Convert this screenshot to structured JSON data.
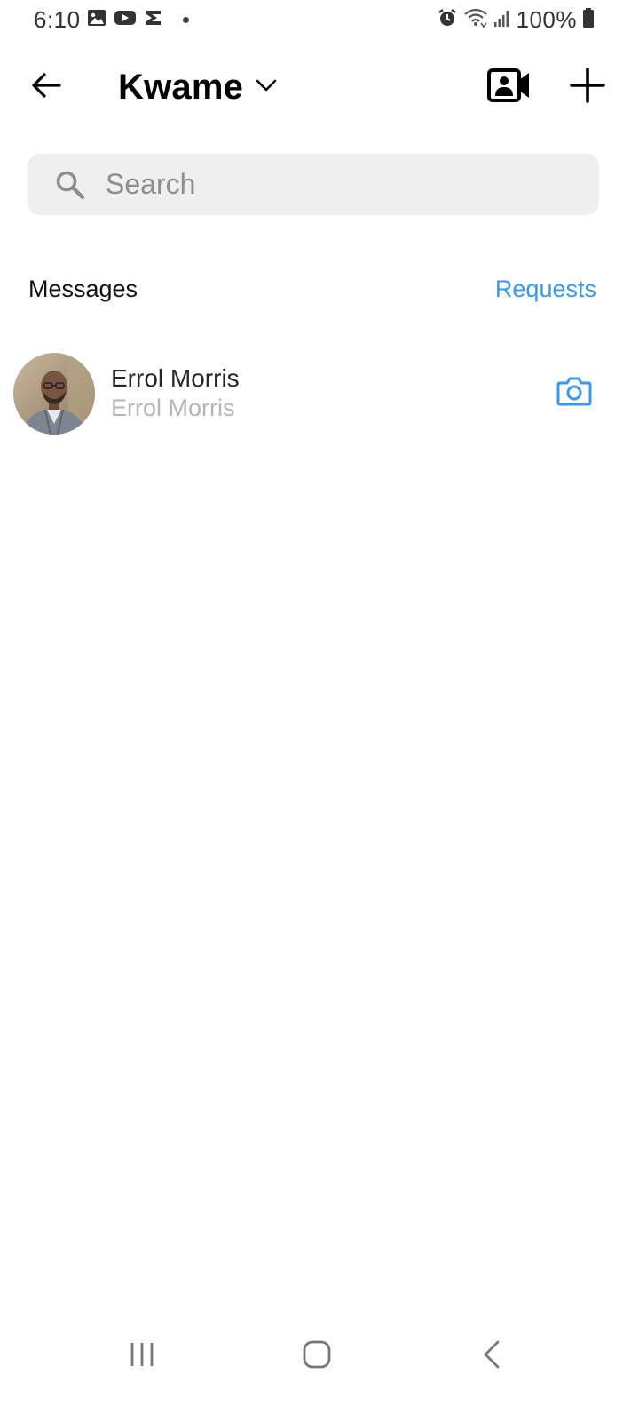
{
  "status_bar": {
    "time": "6:10",
    "battery": "100%",
    "left_icons": [
      "gallery-icon",
      "youtube-icon",
      "s-app-icon",
      "notification-dot"
    ],
    "right_icons": [
      "alarm-icon",
      "wifi-icon",
      "signal-icon",
      "battery-icon"
    ]
  },
  "header": {
    "account_name": "Kwame",
    "back_icon": "arrow-left-icon",
    "switcher_icon": "chevron-down-icon",
    "video_icon": "video-call-icon",
    "new_icon": "plus-icon"
  },
  "search": {
    "placeholder": "Search",
    "value": ""
  },
  "section": {
    "title": "Messages",
    "requests_label": "Requests"
  },
  "conversations": [
    {
      "name": "Errol Morris",
      "preview": "Errol Morris",
      "action_icon": "camera-icon"
    }
  ],
  "nav_bar": {
    "buttons": [
      "recent-apps-icon",
      "home-icon",
      "back-nav-icon"
    ]
  },
  "colors": {
    "accent": "#3897f0",
    "search_bg": "#efefef",
    "muted_text": "#b5b5b5"
  }
}
